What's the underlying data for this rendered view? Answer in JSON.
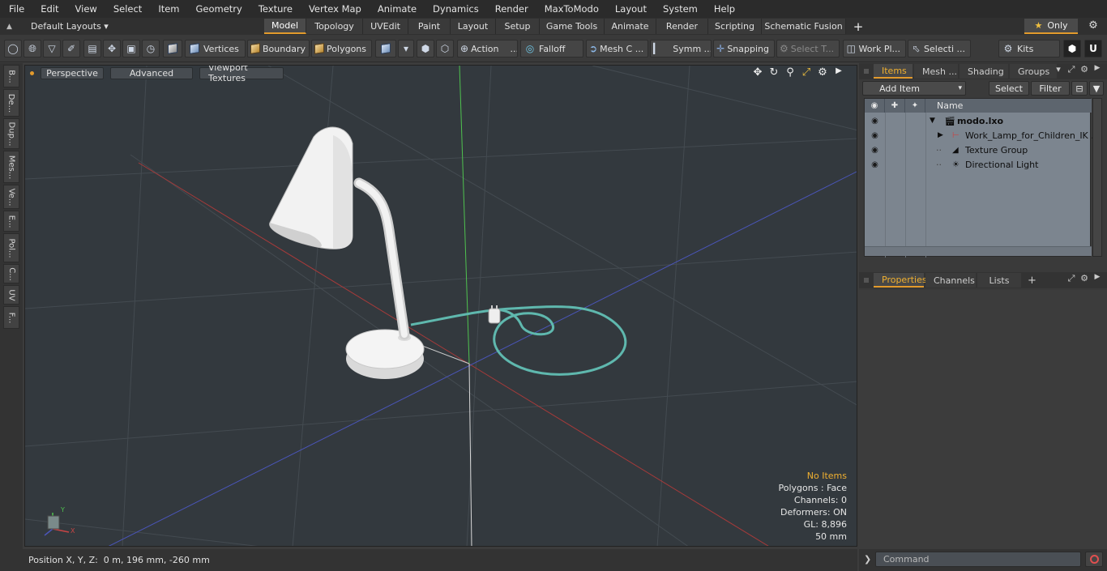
{
  "menu": [
    "File",
    "Edit",
    "View",
    "Select",
    "Item",
    "Geometry",
    "Texture",
    "Vertex Map",
    "Animate",
    "Dynamics",
    "Render",
    "MaxToModo",
    "Layout",
    "System",
    "Help"
  ],
  "layout_selector": "Default Layouts ▾",
  "tabs": [
    {
      "label": "Model",
      "active": true
    },
    {
      "label": "Topology"
    },
    {
      "label": "UVEdit"
    },
    {
      "label": "Paint"
    },
    {
      "label": "Layout"
    },
    {
      "label": "Setup"
    },
    {
      "label": "Game Tools"
    },
    {
      "label": "Animate"
    },
    {
      "label": "Render"
    },
    {
      "label": "Scripting"
    },
    {
      "label": "Schematic Fusion"
    }
  ],
  "only_label": "Only",
  "toolbar": {
    "vertices": "Vertices",
    "boundary": "Boundary",
    "polygons": "Polygons",
    "action": "Action",
    "action_more": "...",
    "falloff": "Falloff",
    "mesh": "Mesh C ...",
    "symm": "Symm ...",
    "snapping": "Snapping",
    "select_t": "Select T...",
    "work_pl": "Work Pl...",
    "selecti": "Selecti ...",
    "kits": "Kits"
  },
  "left_tabs": [
    "B...",
    "De...",
    "Dup...",
    "Mes...",
    "Ve...",
    "E...",
    "Pol...",
    "C...",
    "UV",
    "F..."
  ],
  "viewport": {
    "buttons": [
      "Perspective",
      "Advanced",
      "Viewport Textures"
    ],
    "info": {
      "items": "No Items",
      "polygons": "Polygons : Face",
      "channels": "Channels: 0",
      "deformers": "Deformers: ON",
      "gl": "GL: 8,896",
      "scale": "50 mm"
    },
    "axis_labels": {
      "y": "Y",
      "x": "X"
    }
  },
  "items_panel": {
    "tabs": [
      "Items",
      "Mesh ...",
      "Shading",
      "Groups"
    ],
    "add_item": "Add Item",
    "select": "Select",
    "filter": "Filter",
    "name_header": "Name",
    "tree": [
      {
        "label": "modo.lxo",
        "bold": true
      },
      {
        "label": "Work_Lamp_for_Children_IK ..."
      },
      {
        "label": "Texture Group"
      },
      {
        "label": "Directional Light"
      }
    ]
  },
  "properties_panel": {
    "tabs": [
      "Properties",
      "Channels",
      "Lists"
    ]
  },
  "status": {
    "position": "Position X, Y, Z:  0 m, 196 mm, -260 mm"
  },
  "command": {
    "placeholder": "Command"
  }
}
